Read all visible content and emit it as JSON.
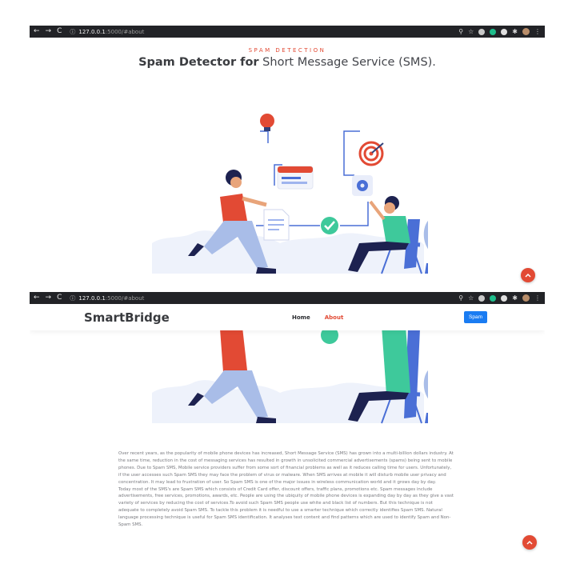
{
  "browser": {
    "host": "127.0.0.1",
    "path": ":5000/#about",
    "nav_back": "←",
    "nav_forward": "→",
    "nav_reload": "C",
    "info": "ⓘ"
  },
  "screen1": {
    "section_tag": "SPAM DETECTION",
    "title_bold": "Spam Detector for",
    "title_light": " Short Message Service (SMS)."
  },
  "screen2": {
    "brand": "SmartBridge",
    "nav": {
      "home": "Home",
      "about": "About"
    },
    "spam_button": "Spam",
    "about_paragraphs": [
      "Over recent years, as the popularity of mobile phone devices has increased, Short Message Service (SMS) has grown into a multi-billion dollars industry. At the same time, reduction in the cost of messaging services has resulted in growth in unsolicited commercial advertisements (spams) being sent to mobile phones. Due to Spam SMS, Mobile service providers suffer from some sort of financial problems as well as it reduces calling time for users. Unfortunately, if the user accesses such Spam SMS they may face the problem of virus or malware. When SMS arrives at mobile it will disturb mobile user privacy and concentration. It may lead to frustration of user. So Spam SMS is one of the major issues in wireless communication world and it grows day by day.",
      "Today most of the SMS's are Spam SMS which consists of Credit Card offer, discount offers, traffic plans, promotions etc. Spam messages include advertisements, free services, promotions, awards, etc. People are using the ubiquity of mobile phone devices is expanding day by day as they give a vast variety of services by reducing the cost of services.To avoid such Spam SMS people use white and black list of numbers. But this technique is not adequate to completely avoid Spam SMS. To tackle this problem it is needful to use a smarter technique which correctly identifies Spam SMS. Natural language processing technique is useful for Spam SMS identification. It analyses text content and find patterns which are used to identify Spam and Non-Spam SMS."
    ]
  },
  "colors": {
    "accent": "#e24a34",
    "button": "#1a7cf2",
    "chrome": "#222327"
  }
}
